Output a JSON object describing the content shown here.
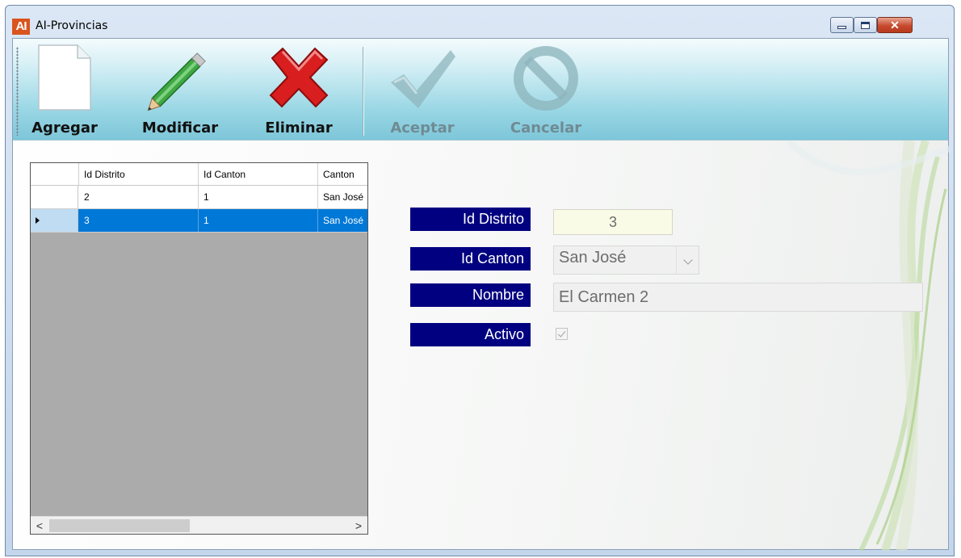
{
  "window": {
    "app_icon": "AI",
    "title": "AI-Provincias",
    "minimize_icon": "minimize-icon",
    "maximize_icon": "maximize-icon",
    "close_glyph": "✕"
  },
  "toolbar": {
    "agregar": "Agregar",
    "modificar": "Modificar",
    "eliminar": "Eliminar",
    "aceptar": "Aceptar",
    "cancelar": "Cancelar"
  },
  "grid": {
    "columns": [
      "Id Distrito",
      "Id Canton",
      "Canton"
    ],
    "rows": [
      {
        "cells": [
          "2",
          "1",
          "San José"
        ],
        "selected": false
      },
      {
        "cells": [
          "3",
          "1",
          "San José"
        ],
        "selected": true
      }
    ],
    "scroll_left": "<",
    "scroll_right": ">"
  },
  "form": {
    "id_distrito_label": "Id Distrito",
    "id_distrito_value": "3",
    "id_canton_label": "Id Canton",
    "id_canton_value": "San José",
    "nombre_label": "Nombre",
    "nombre_value": "El Carmen 2",
    "activo_label": "Activo",
    "activo_checked": true
  },
  "colors": {
    "label_bg": "#000080",
    "selected_row": "#0078d7",
    "toolbar_accent": "#7dc6d9"
  }
}
